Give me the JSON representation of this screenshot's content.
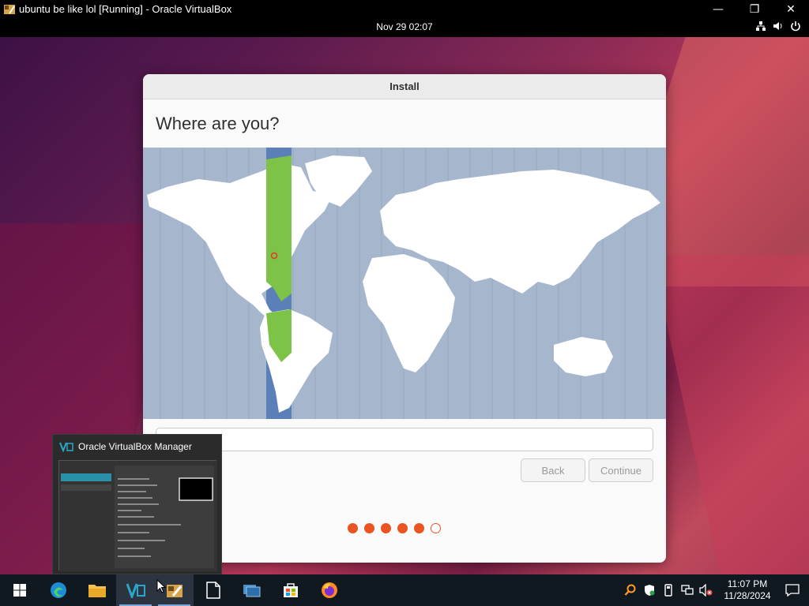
{
  "window": {
    "title": "ubuntu be like lol [Running] - Oracle VirtualBox",
    "minimize_glyph": "—",
    "maximize_glyph": "❐",
    "close_glyph": "✕"
  },
  "guest_topbar": {
    "datetime": "Nov 29  02:07",
    "icons": [
      "network-icon",
      "volume-icon",
      "power-icon"
    ]
  },
  "installer": {
    "window_title": "Install",
    "heading": "Where are you?",
    "location_value": "New York",
    "back_label": "Back",
    "continue_label": "Continue",
    "progress_total": 6,
    "progress_done": 5,
    "colors": {
      "accent": "#e95420",
      "ocean": "#a6b6cc",
      "land": "#ffffff",
      "selected_timezone": "#7cc348",
      "timezone_band": "#5b7fb8"
    }
  },
  "taskbar_preview": {
    "title": "Oracle VirtualBox Manager"
  },
  "taskbar": {
    "apps": [
      "start-icon",
      "edge-icon",
      "file-explorer-icon",
      "virtualbox-manager-icon",
      "virtualbox-vm-icon",
      "notepad-icon",
      "task-view-icon",
      "store-icon",
      "firefox-icon"
    ],
    "tray_icons": [
      "search-icon",
      "defender-icon",
      "usb-icon",
      "network-icon",
      "volume-icon"
    ],
    "time": "11:07 PM",
    "date": "11/28/2024"
  }
}
